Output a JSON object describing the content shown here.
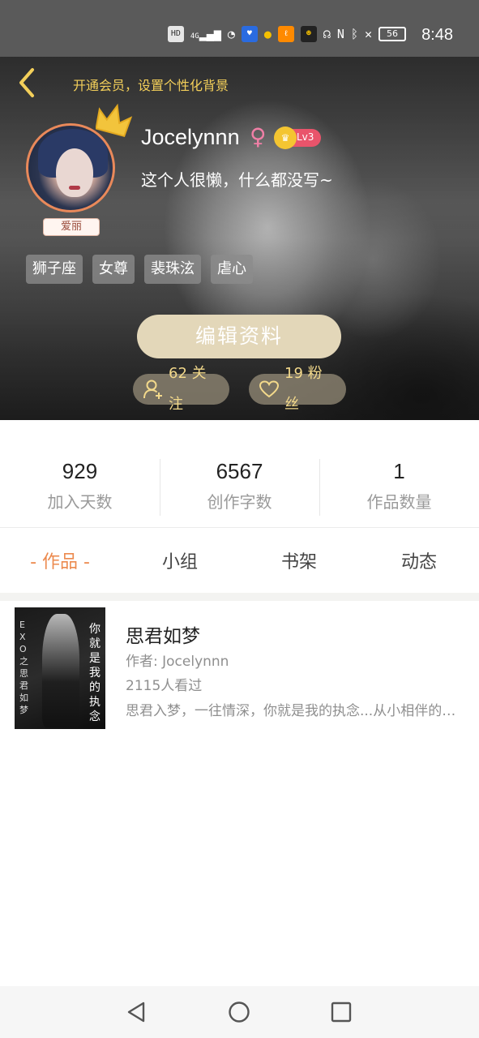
{
  "status_bar": {
    "time": "8:48",
    "battery": "56",
    "hd_label": "HD",
    "signal_label": "4G",
    "icons": [
      "hd-icon",
      "signal-icon",
      "wifi-icon",
      "app-icon-blue",
      "app-icon-yellow",
      "app-icon-orange",
      "app-icon-dark",
      "headphones-icon",
      "nfc-icon",
      "bluetooth-icon",
      "mute-icon",
      "battery-icon"
    ]
  },
  "profile": {
    "vip_hint": "开通会员，设置个性化背景",
    "username": "Jocelynnn",
    "gender_symbol": "♀",
    "level": "Lv3",
    "bio": "这个人很懒，什么都没写~",
    "avatar_tag": "爱丽",
    "tags": [
      "狮子座",
      "女尊",
      "裴珠泫",
      "虐心"
    ],
    "edit_button": "编辑资料",
    "following": "62 关注",
    "fans": "19 粉丝"
  },
  "stats": [
    {
      "value": "929",
      "label": "加入天数"
    },
    {
      "value": "6567",
      "label": "创作字数"
    },
    {
      "value": "1",
      "label": "作品数量"
    }
  ],
  "tabs": [
    {
      "label": "- 作品 -",
      "active": true
    },
    {
      "label": "小组",
      "active": false
    },
    {
      "label": "书架",
      "active": false
    },
    {
      "label": "动态",
      "active": false
    }
  ],
  "work": {
    "title": "思君如梦",
    "author": "作者: Jocelynnn",
    "views": "2115人看过",
    "description": "思君入梦，一往情深，你就是我的执念...从小相伴的青梅竹马",
    "cover_left_text": "EXO之思君如梦",
    "cover_right_text": "你就是我的执念"
  },
  "colors": {
    "accent": "#ec8a4e",
    "gold": "#f3cf5a",
    "edit_button": "#e3d7b9",
    "status_bar": "#5a5a5a"
  },
  "nav": {
    "icons": [
      "back-triangle-icon",
      "home-circle-icon",
      "recents-square-icon"
    ]
  }
}
